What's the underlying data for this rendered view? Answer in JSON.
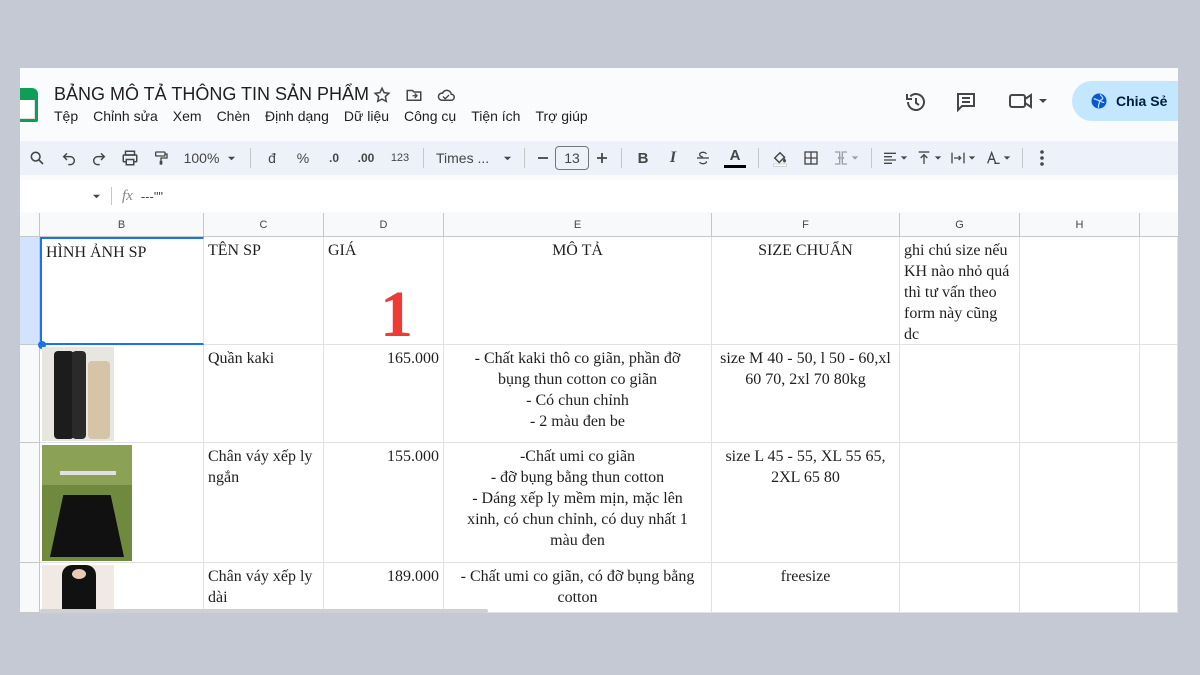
{
  "doc": {
    "title": "BẢNG MÔ TẢ THÔNG TIN SẢN PHẨM"
  },
  "menu": [
    "Tệp",
    "Chỉnh sửa",
    "Xem",
    "Chèn",
    "Định dạng",
    "Dữ liệu",
    "Công cụ",
    "Tiện ích",
    "Trợ giúp"
  ],
  "share": {
    "label": "Chia Sẻ"
  },
  "toolbar": {
    "zoom": "100%",
    "currency": "đ",
    "percent": "%",
    "dec_decrease": ".0",
    "dec_increase": ".00",
    "number_format": "123",
    "font": "Times ...",
    "font_size": "13"
  },
  "formula_bar": {
    "fx": "fx",
    "value": "---\"\""
  },
  "columns": [
    "B",
    "C",
    "D",
    "E",
    "F",
    "G",
    "H"
  ],
  "header_row": {
    "image": "HÌNH ẢNH SP",
    "name": "TÊN SP",
    "price": "GIÁ",
    "desc": "MÔ TẢ",
    "size": "SIZE CHUẨN",
    "note": "ghi chú size nếu KH nào nhỏ quá thì tư vấn theo form này cũng dc"
  },
  "marker": "1",
  "rows": [
    {
      "name": "Quần kaki",
      "price": "165.000",
      "desc": [
        "- Chất kaki thô co giãn, phần đỡ",
        "bụng thun cotton co giãn",
        "- Có chun chỉnh",
        "- 2 màu đen be"
      ],
      "size": "size M 40 - 50, l 50 - 60,xl 60 70, 2xl 70 80kg"
    },
    {
      "name": "Chân váy xếp ly ngắn",
      "price": "155.000",
      "desc": [
        "-Chất umi co giãn",
        "- đỡ bụng bằng thun cotton",
        "- Dáng xếp ly mềm mịn, mặc lên",
        "xinh, có chun chỉnh, có duy nhất 1",
        "màu đen"
      ],
      "size": "size L 45 - 55, XL 55 65, 2XL 65 80"
    },
    {
      "name": "Chân váy xếp ly dài",
      "price": "189.000",
      "desc": [
        "- Chất umi co giãn, có đỡ bụng bằng",
        "cotton"
      ],
      "size": "freesize"
    }
  ]
}
